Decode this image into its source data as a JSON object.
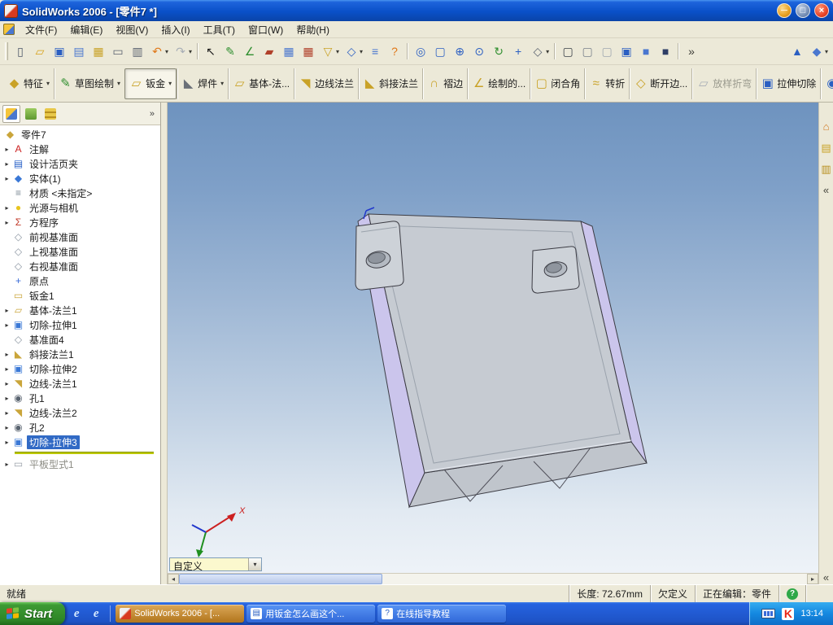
{
  "colors": {
    "selection": "#316AC5",
    "viewport_top": "#6E93BF",
    "viewport_bottom": "#F0F4F9",
    "model_face": "#C6CBD2",
    "model_wall": "#CBC5EC",
    "rollback_bar": "#BCC800",
    "taskbar_active_button": "#B57A22"
  },
  "window": {
    "title": "SolidWorks 2006 - [零件7 *]"
  },
  "menu": {
    "items": [
      "文件(F)",
      "编辑(E)",
      "视图(V)",
      "插入(I)",
      "工具(T)",
      "窗口(W)",
      "帮助(H)"
    ]
  },
  "toolbar_standard": {
    "items": [
      {
        "name": "new-document",
        "g": "▯",
        "c": "#4a5568"
      },
      {
        "name": "open-folder",
        "g": "▱",
        "c": "#d8a21a"
      },
      {
        "name": "save",
        "g": "▣",
        "c": "#2b5fc2"
      },
      {
        "name": "make-drawing-from-part",
        "g": "▤",
        "c": "#4a77cf"
      },
      {
        "name": "make-assembly-from-part",
        "g": "▦",
        "c": "#c9a227"
      },
      {
        "name": "print",
        "g": "▭",
        "c": "#5a6270"
      },
      {
        "name": "print-preview",
        "g": "▥",
        "c": "#5a6270"
      },
      {
        "name": "undo",
        "g": "↶",
        "c": "#e07818",
        "caret": true
      },
      {
        "name": "redo",
        "g": "↷",
        "c": "#a8aeb6",
        "caret": true
      },
      {
        "sep": true
      },
      {
        "name": "select",
        "g": "↖",
        "c": "#1a1a1a"
      },
      {
        "name": "sketch",
        "g": "✎",
        "c": "#2f8f2f"
      },
      {
        "name": "smart-dimension",
        "g": "∠",
        "c": "#2f8f2f"
      },
      {
        "name": "edit-color",
        "g": "▰",
        "c": "#b0402a"
      },
      {
        "name": "grid",
        "g": "▦",
        "c": "#4a77cf"
      },
      {
        "name": "section-hatch",
        "g": "▦",
        "c": "#b0402a"
      },
      {
        "name": "selection-filter",
        "g": "▽",
        "c": "#c9a227",
        "caret": true
      },
      {
        "name": "quick-snaps",
        "g": "◇",
        "c": "#2b5fc2",
        "caret": true
      },
      {
        "name": "measure",
        "g": "≡",
        "c": "#4a77cf"
      },
      {
        "name": "help",
        "g": "?",
        "c": "#e07818"
      },
      {
        "sep": true
      },
      {
        "name": "zoom-to-fit",
        "g": "◎",
        "c": "#2b5fc2"
      },
      {
        "name": "zoom-to-area",
        "g": "▢",
        "c": "#2b5fc2"
      },
      {
        "name": "zoom-in-out",
        "g": "⊕",
        "c": "#2b5fc2"
      },
      {
        "name": "zoom-to-selection",
        "g": "⊙",
        "c": "#2b5fc2"
      },
      {
        "name": "rotate-view",
        "g": "↻",
        "c": "#2f8f2f"
      },
      {
        "name": "pan",
        "g": "+",
        "c": "#2b5fc2"
      },
      {
        "name": "standard-views",
        "g": "◇",
        "c": "#5a6270",
        "caret": true
      },
      {
        "sep": true
      },
      {
        "name": "wireframe",
        "g": "▢",
        "c": "#3a4048"
      },
      {
        "name": "hidden-lines-visible",
        "g": "▢",
        "c": "#7a828c"
      },
      {
        "name": "hidden-lines-removed",
        "g": "▢",
        "c": "#a0a8b0"
      },
      {
        "name": "shaded-with-edges",
        "g": "▣",
        "c": "#2b5fc2"
      },
      {
        "name": "shaded",
        "g": "■",
        "c": "#4a77cf"
      },
      {
        "name": "shadows-in-shaded-mode",
        "g": "■",
        "c": "#2e3e66"
      },
      {
        "sep": true
      },
      {
        "name": "toolbar-overflow",
        "g": "»",
        "c": "#3a3a34"
      },
      {
        "spring": true
      },
      {
        "name": "view-orientation",
        "g": "▲",
        "c": "#2b5fc2"
      },
      {
        "name": "display-settings",
        "g": "◆",
        "c": "#4a77cf",
        "caret": true
      }
    ]
  },
  "toolbar_sheetmetal": {
    "items": [
      {
        "name": "features",
        "label": "特征",
        "g": "◆",
        "c": "#c9a227",
        "caret": true
      },
      {
        "name": "sketch-mode",
        "label": "草图绘制",
        "g": "✎",
        "c": "#2f8f2f",
        "caret": true
      },
      {
        "name": "sheet-metal",
        "label": "钣金",
        "g": "▱",
        "c": "#c9a227",
        "caret": true,
        "pressed": true
      },
      {
        "name": "weldments",
        "label": "焊件",
        "g": "◣",
        "c": "#6a7078",
        "caret": true
      },
      {
        "name": "base-flange",
        "label": "基体-法...",
        "g": "▱",
        "c": "#c9a227"
      },
      {
        "name": "edge-flange",
        "label": "边线法兰",
        "g": "◥",
        "c": "#c9a227"
      },
      {
        "name": "miter-flange",
        "label": "斜接法兰",
        "g": "◣",
        "c": "#c9a227"
      },
      {
        "name": "hem",
        "label": "褶边",
        "g": "∩",
        "c": "#c9a227"
      },
      {
        "name": "sketched-bend",
        "label": "绘制的...",
        "g": "∠",
        "c": "#c9a227"
      },
      {
        "name": "closed-corner",
        "label": "闭合角",
        "g": "▢",
        "c": "#c9a227"
      },
      {
        "name": "jog",
        "label": "转折",
        "g": "≈",
        "c": "#c9a227"
      },
      {
        "name": "break-corner",
        "label": "断开边...",
        "g": "◇",
        "c": "#c9a227"
      },
      {
        "name": "lofted-bend",
        "label": "放样折弯",
        "g": "▱",
        "c": "#a8aeb6",
        "disabled": true
      },
      {
        "name": "extruded-cut",
        "label": "拉伸切除",
        "g": "▣",
        "c": "#2b5fc2"
      },
      {
        "name": "simple-hole",
        "label": "简单直孔",
        "g": "◉",
        "c": "#2b5fc2"
      }
    ]
  },
  "feature_tree": {
    "items": [
      {
        "name": "part-root",
        "label": "零件7",
        "g": "◆",
        "c": "#caa53a",
        "root": true
      },
      {
        "name": "annotations",
        "label": "注解",
        "g": "A",
        "c": "#cc2222",
        "exp": true
      },
      {
        "name": "design-binder",
        "label": "设计活页夹",
        "g": "▤",
        "c": "#2a62c8",
        "exp": true
      },
      {
        "name": "solid-bodies",
        "label": "实体(1)",
        "g": "◆",
        "c": "#3a78d6",
        "exp": true
      },
      {
        "name": "material",
        "label": "材质 <未指定>",
        "g": "≡",
        "c": "#7d8a96"
      },
      {
        "name": "lights-cameras",
        "label": "光源与相机",
        "g": "●",
        "c": "#e8c51f",
        "exp": true
      },
      {
        "name": "equations",
        "label": "方程序",
        "g": "Σ",
        "c": "#c23a2a",
        "exp": true
      },
      {
        "name": "front-plane",
        "label": "前视基准面",
        "g": "◇",
        "c": "#8a94a0"
      },
      {
        "name": "top-plane",
        "label": "上视基准面",
        "g": "◇",
        "c": "#8a94a0"
      },
      {
        "name": "right-plane",
        "label": "右视基准面",
        "g": "◇",
        "c": "#8a94a0"
      },
      {
        "name": "origin",
        "label": "原点",
        "g": "+",
        "c": "#3a6bd8"
      },
      {
        "name": "sheet-metal1",
        "label": "钣金1",
        "g": "▭",
        "c": "#caa53a"
      },
      {
        "name": "base-flange1",
        "label": "基体-法兰1",
        "g": "▱",
        "c": "#caa53a",
        "exp": true
      },
      {
        "name": "cut-extrude1",
        "label": "切除-拉伸1",
        "g": "▣",
        "c": "#3a78d6",
        "exp": true
      },
      {
        "name": "plane4",
        "label": "基准面4",
        "g": "◇",
        "c": "#8a94a0"
      },
      {
        "name": "miter-flange1",
        "label": "斜接法兰1",
        "g": "◣",
        "c": "#caa53a",
        "exp": true
      },
      {
        "name": "cut-extrude2",
        "label": "切除-拉伸2",
        "g": "▣",
        "c": "#3a78d6",
        "exp": true
      },
      {
        "name": "edge-flange1",
        "label": "边线-法兰1",
        "g": "◥",
        "c": "#caa53a",
        "exp": true
      },
      {
        "name": "hole1",
        "label": "孔1",
        "g": "◉",
        "c": "#5a6470",
        "exp": true
      },
      {
        "name": "edge-flange2",
        "label": "边线-法兰2",
        "g": "◥",
        "c": "#caa53a",
        "exp": true
      },
      {
        "name": "hole2",
        "label": "孔2",
        "g": "◉",
        "c": "#5a6470",
        "exp": true
      },
      {
        "name": "cut-extrude3",
        "label": "切除-拉伸3",
        "g": "▣",
        "c": "#3a78d6",
        "exp": true,
        "selected": true
      },
      {
        "type": "rollback"
      },
      {
        "name": "flat-pattern1",
        "label": "平板型式1",
        "g": "▭",
        "c": "#9aa0a8",
        "exp": true,
        "dim": true
      }
    ]
  },
  "viewport": {
    "view_selector": "自定义",
    "triad_x": "X"
  },
  "right_panel": {
    "items": [
      {
        "name": "solidworks-resources",
        "g": "⌂",
        "c": "#d07820"
      },
      {
        "name": "design-library",
        "g": "▤",
        "c": "#c9a227"
      },
      {
        "name": "file-explorer",
        "g": "▥",
        "c": "#b89020"
      },
      {
        "name": "collapse-task-pane",
        "g": "«",
        "c": "#44443c"
      },
      {
        "spring": true
      },
      {
        "name": "collapse-lower-pane",
        "g": "«",
        "c": "#44443c"
      }
    ]
  },
  "status_bar": {
    "ready": "就绪",
    "length": "长度: 72.67mm",
    "definition": "欠定义",
    "editing": "正在编辑：零件"
  },
  "taskbar": {
    "start_label": "Start",
    "quick_launch": [
      {
        "name": "internet-explorer",
        "g": "e",
        "c": "#D6E9FF"
      },
      {
        "name": "internet-explorer-2",
        "g": "e",
        "c": "#D6E9FF"
      }
    ],
    "tasks": [
      {
        "name": "task-solidworks",
        "label": "SolidWorks 2006 - [...",
        "icon": "sw",
        "icon_glyph": "",
        "active": true
      },
      {
        "name": "task-browser-thread",
        "label": "用钣金怎么画这个...",
        "icon": "page",
        "icon_glyph": "▤"
      },
      {
        "name": "task-online-tutorial",
        "label": "在线指导教程",
        "icon": "tutorial",
        "icon_glyph": "?"
      }
    ],
    "tray": {
      "time": "13:14"
    }
  }
}
